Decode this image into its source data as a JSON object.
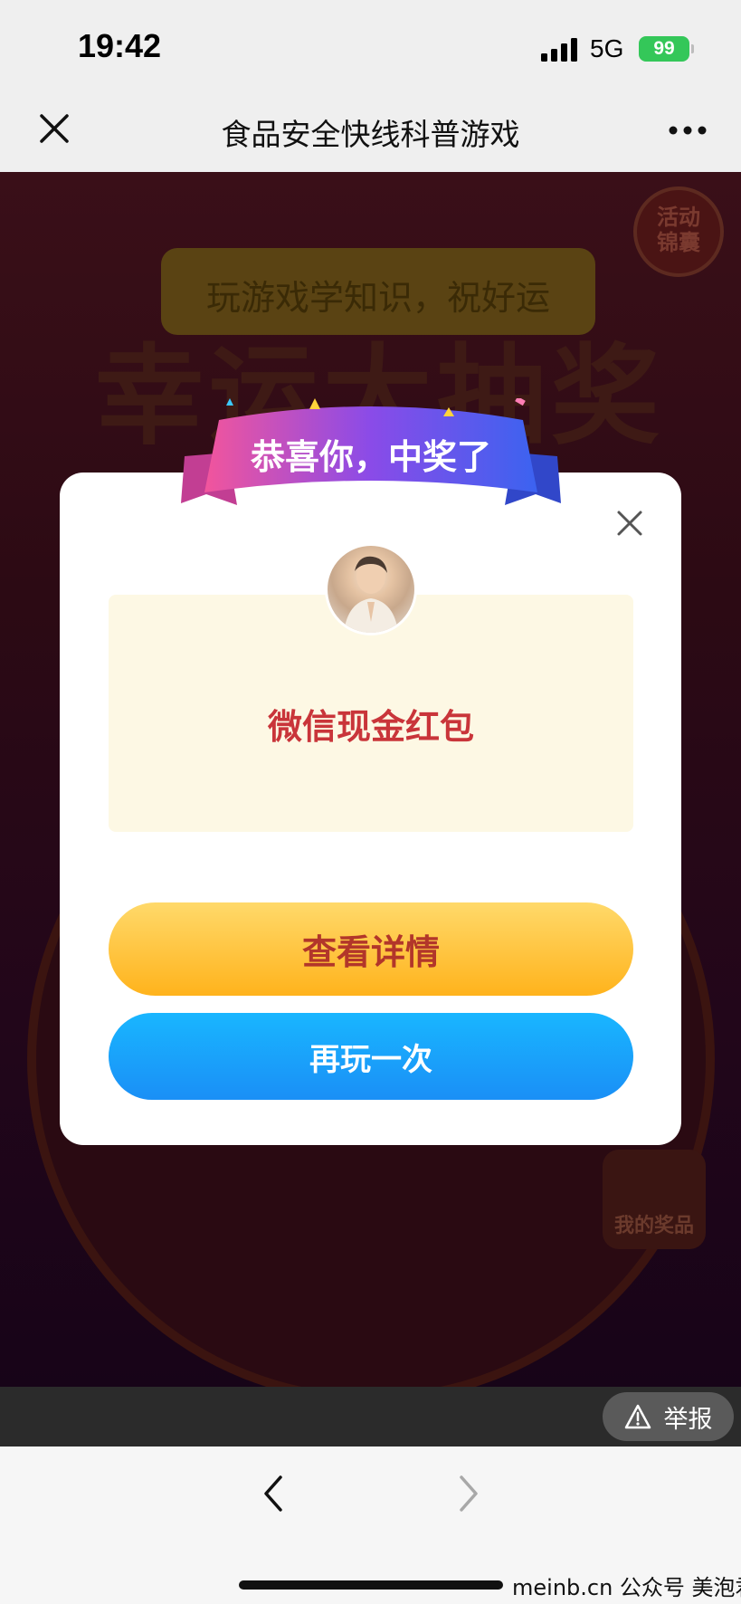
{
  "status_bar": {
    "time": "19:42",
    "network": "5G",
    "battery": "99"
  },
  "nav": {
    "title": "食品安全快线科普游戏"
  },
  "game_background": {
    "subtitle": "玩游戏学知识，祝好运",
    "big_title": "幸运大抽奖",
    "activity_badge": "活动\n锦囊",
    "my_prize_label": "我的奖品"
  },
  "modal": {
    "ribbon_text": "恭喜你，中奖了",
    "prize_name": "微信现金红包",
    "detail_button": "查看详情",
    "play_again_button": "再玩一次"
  },
  "report": {
    "label": "举报"
  },
  "watermark": "meinb.cn  公众号 美泡君",
  "colors": {
    "prize_text": "#c9353a",
    "detail_button": "#ffb31c",
    "play_again_button": "#1a8ff6",
    "battery": "#34c759"
  },
  "icons": {
    "nav_close": "close-icon",
    "nav_more": "more-icon",
    "modal_close": "close-icon",
    "report": "warning-icon",
    "back": "chevron-left-icon",
    "forward": "chevron-right-icon"
  }
}
